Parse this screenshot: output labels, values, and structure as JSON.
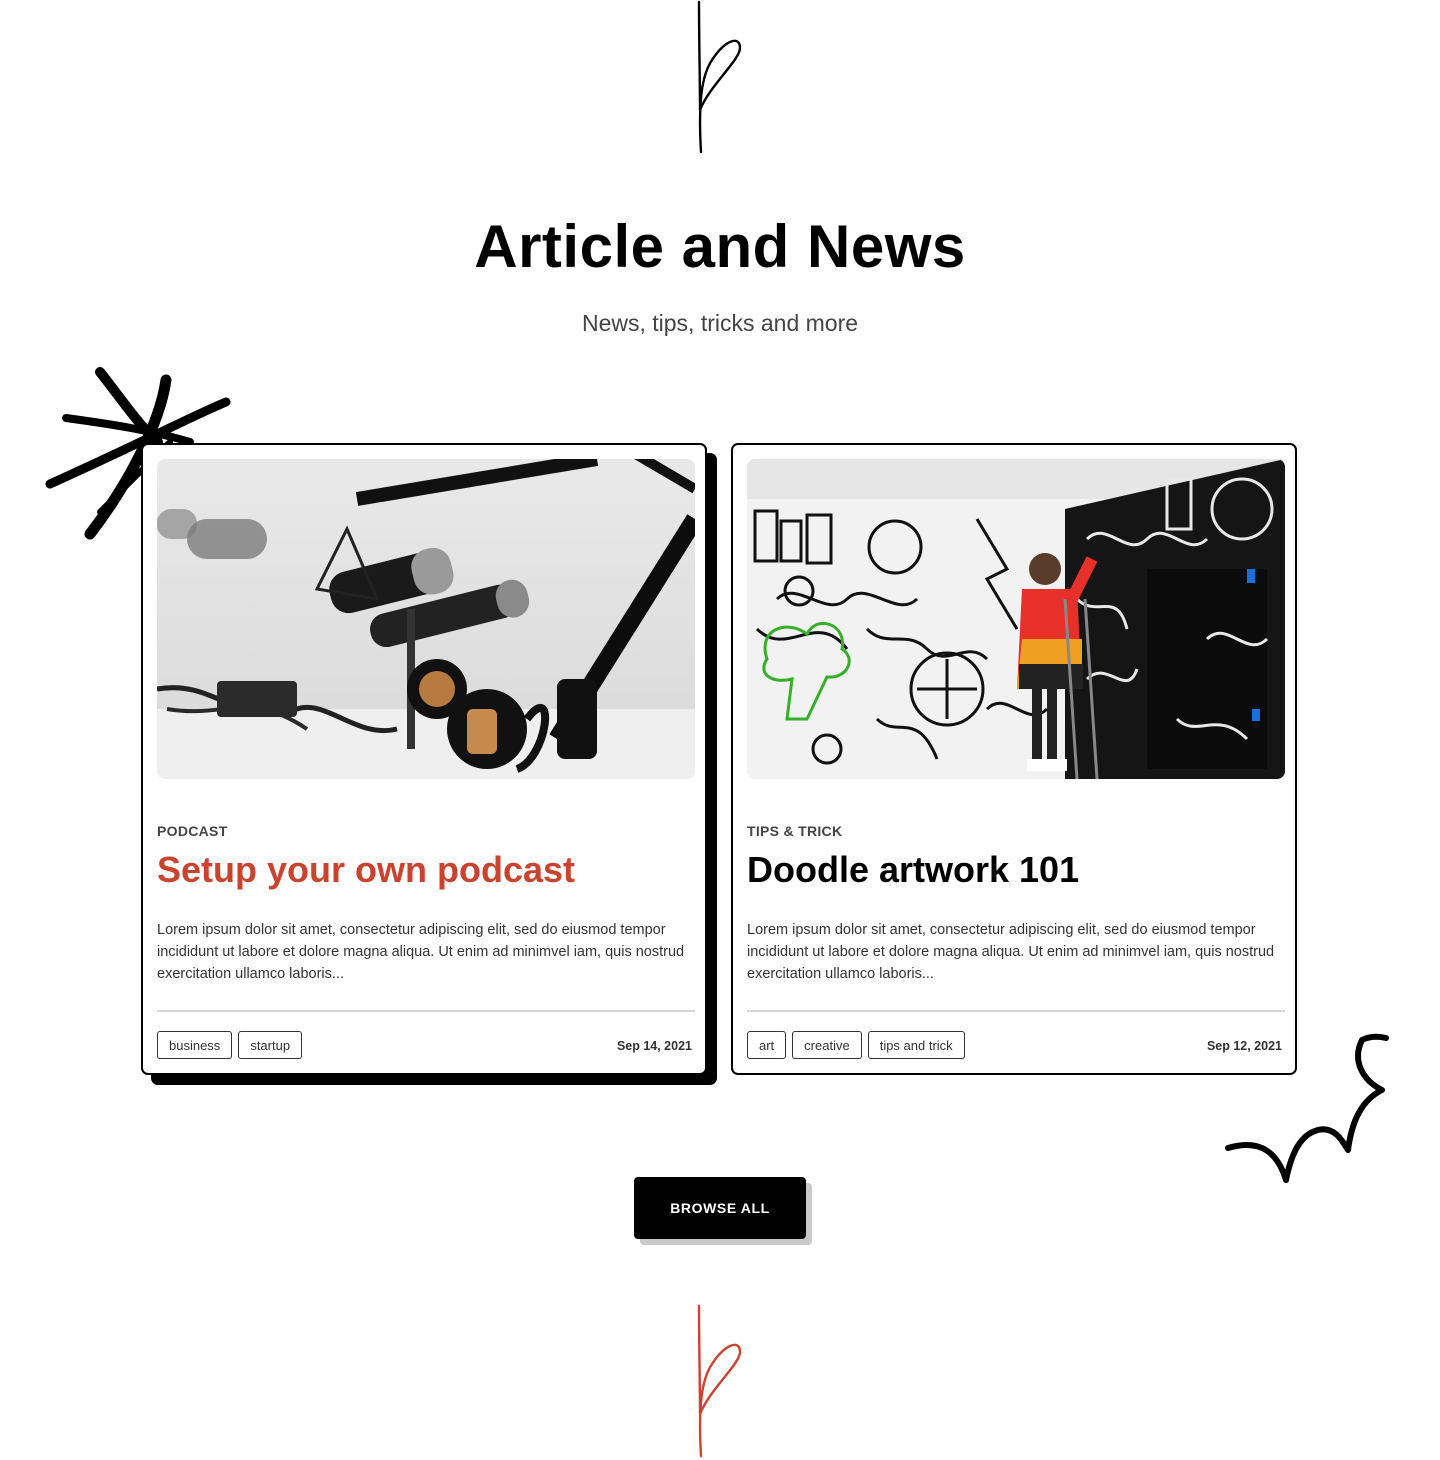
{
  "section": {
    "title": "Article and News",
    "subtitle": "News, tips, tricks and more"
  },
  "colors": {
    "accent": "#c9432e",
    "ink": "#000000",
    "muted": "#444444"
  },
  "articles": [
    {
      "category": "PODCAST",
      "title": "Setup your own podcast",
      "excerpt": "Lorem ipsum dolor sit amet, consectetur adipiscing elit, sed do eiusmod tempor incididunt ut labore et dolore magna aliqua. Ut enim ad minimvel iam, quis nostrud exercitation ullamco laboris...",
      "tags": [
        "business",
        "startup"
      ],
      "date": "Sep 14, 2021",
      "image": "podcast-microphones-photo"
    },
    {
      "category": "TIPS & TRICK",
      "title": "Doodle artwork 101",
      "excerpt": "Lorem ipsum dolor sit amet, consectetur adipiscing elit, sed do eiusmod tempor incididunt ut labore et dolore magna aliqua. Ut enim ad minimvel iam, quis nostrud exercitation ullamco laboris...",
      "tags": [
        "art",
        "creative",
        "tips and trick"
      ],
      "date": "Sep 12, 2021",
      "image": "doodle-wall-artist-photo"
    }
  ],
  "browse_button": {
    "label": "BROWSE ALL"
  },
  "decorations": [
    "squiggle-icon",
    "asterisk-doodle-icon",
    "wiggle-doodle-icon",
    "squiggle-icon-red"
  ]
}
